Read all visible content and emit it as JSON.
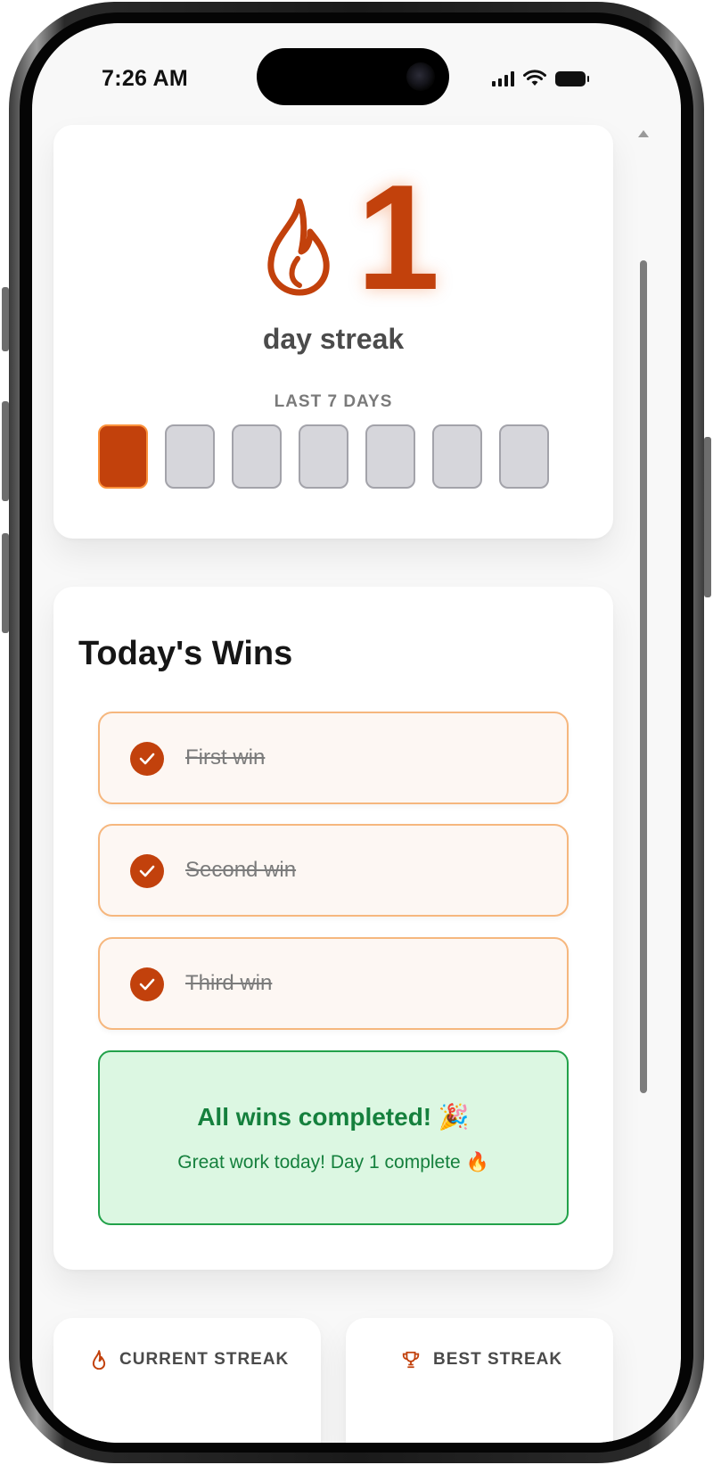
{
  "status_bar": {
    "time": "7:26 AM"
  },
  "streak": {
    "count": "1",
    "label": "day streak",
    "days_label": "LAST 7 DAYS",
    "days_completed": [
      true,
      false,
      false,
      false,
      false,
      false,
      false
    ]
  },
  "wins": {
    "title": "Today's Wins",
    "items": [
      {
        "label": "First win",
        "done": true
      },
      {
        "label": "Second win",
        "done": true
      },
      {
        "label": "Third win",
        "done": true
      }
    ],
    "complete_title": "All wins completed! 🎉",
    "complete_subtitle": "Great work today! Day 1 complete 🔥"
  },
  "stats": {
    "current_label": "CURRENT STREAK",
    "best_label": "BEST STREAK"
  },
  "colors": {
    "accent": "#c2410c",
    "success": "#15803d",
    "success_bg": "#dcf7e2"
  },
  "icons": {
    "streak": "flame-icon",
    "check": "check-icon",
    "best": "trophy-icon"
  }
}
